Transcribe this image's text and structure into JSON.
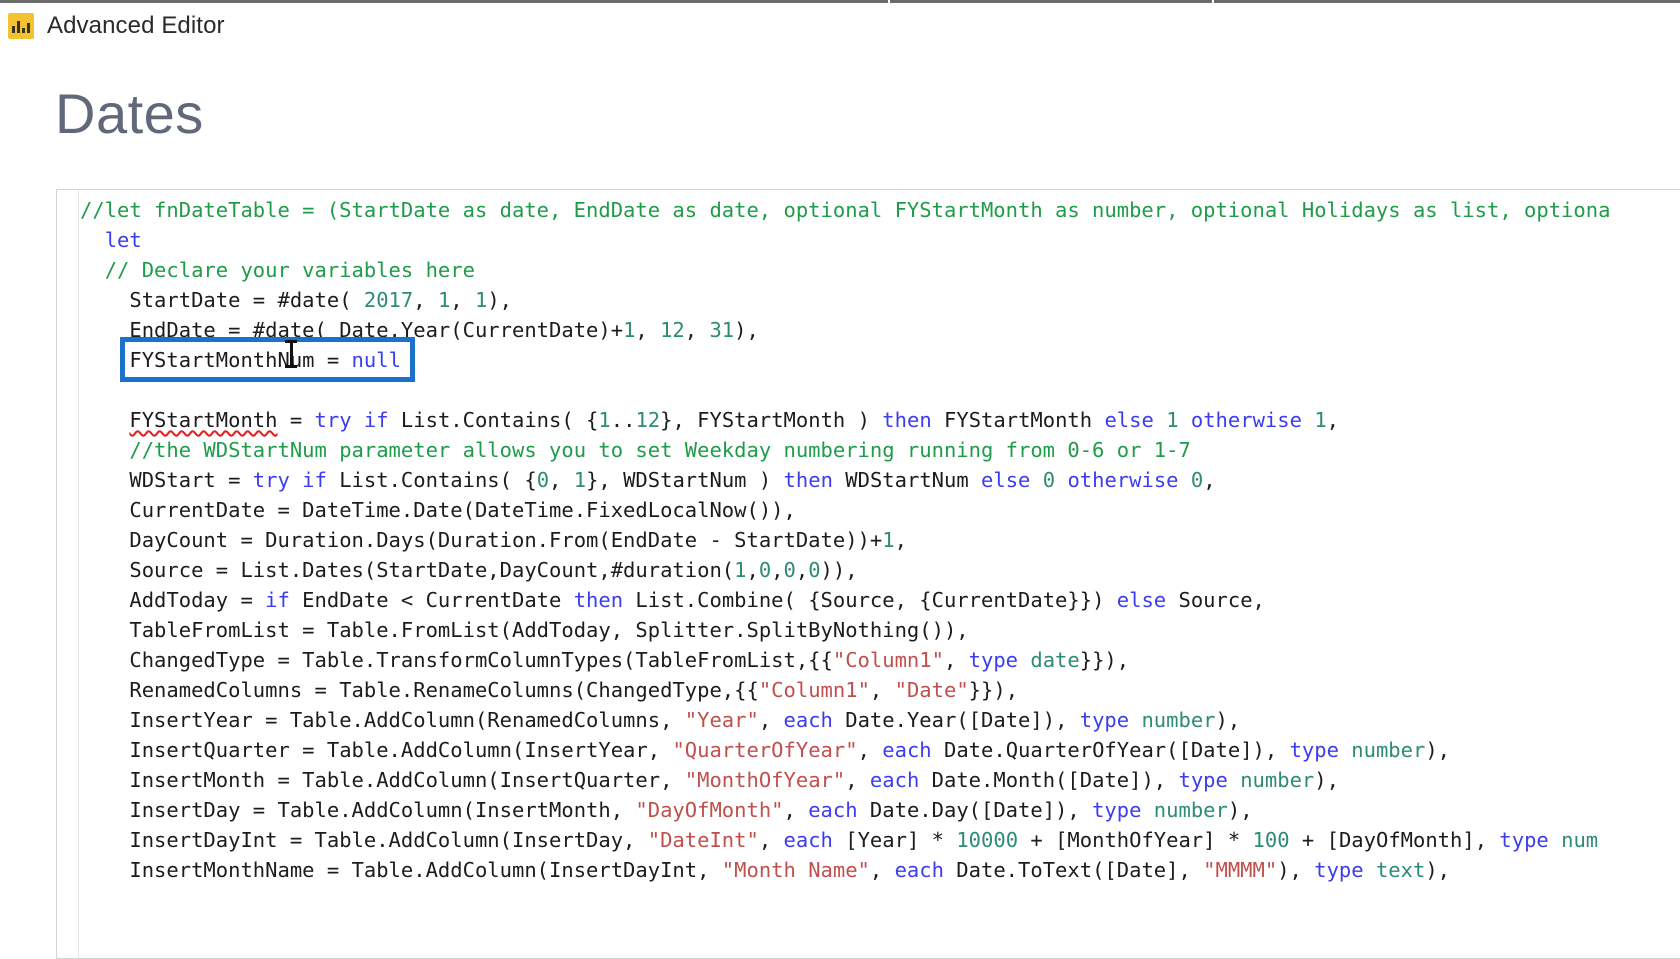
{
  "window": {
    "title": "Advanced Editor",
    "icon": "powerbi-bar-chart-icon"
  },
  "query": {
    "name": "Dates"
  },
  "editor": {
    "language": "M (Power Query)",
    "highlight_box_color": "#1a73c8",
    "highlighted_text": "FYStartMonthNum = null",
    "cursor": "text-ibeam-cursor",
    "lines": [
      {
        "indent": 0,
        "tokens": [
          {
            "t": "//let fnDateTable = (StartDate as date, EndDate as date, optional FYStartMonth as number, optional Holidays as list, optiona",
            "c": "cmt"
          }
        ]
      },
      {
        "indent": 1,
        "tokens": [
          {
            "t": "let",
            "c": "kw"
          }
        ]
      },
      {
        "indent": 1,
        "tokens": [
          {
            "t": "// Declare your variables here",
            "c": "cmt"
          }
        ]
      },
      {
        "indent": 2,
        "tokens": [
          {
            "t": "StartDate = #date( ",
            "c": "plain"
          },
          {
            "t": "2017",
            "c": "num"
          },
          {
            "t": ", ",
            "c": "plain"
          },
          {
            "t": "1",
            "c": "num"
          },
          {
            "t": ", ",
            "c": "plain"
          },
          {
            "t": "1",
            "c": "num"
          },
          {
            "t": "),",
            "c": "plain"
          }
        ]
      },
      {
        "indent": 2,
        "tokens": [
          {
            "t": "EndDate = #date( Date.Year(CurrentDate)+",
            "c": "plain"
          },
          {
            "t": "1",
            "c": "num"
          },
          {
            "t": ", ",
            "c": "plain"
          },
          {
            "t": "12",
            "c": "num"
          },
          {
            "t": ", ",
            "c": "plain"
          },
          {
            "t": "31",
            "c": "num"
          },
          {
            "t": "),",
            "c": "plain"
          }
        ]
      },
      {
        "indent": 2,
        "tokens": [
          {
            "t": "FYStartMonthNum = ",
            "c": "plain"
          },
          {
            "t": "null",
            "c": "kw"
          }
        ]
      },
      {
        "indent": 0,
        "tokens": []
      },
      {
        "indent": 2,
        "tokens": [
          {
            "t": "FYStartMonth",
            "c": "sq"
          },
          {
            "t": " = ",
            "c": "plain"
          },
          {
            "t": "try",
            "c": "kw"
          },
          {
            "t": " ",
            "c": "plain"
          },
          {
            "t": "if",
            "c": "kw"
          },
          {
            "t": " List.Contains( {",
            "c": "plain"
          },
          {
            "t": "1",
            "c": "num"
          },
          {
            "t": "..",
            "c": "plain"
          },
          {
            "t": "12",
            "c": "num"
          },
          {
            "t": "}, FYStartMonth ) ",
            "c": "plain"
          },
          {
            "t": "then",
            "c": "kw"
          },
          {
            "t": " FYStartMonth ",
            "c": "plain"
          },
          {
            "t": "else",
            "c": "kw"
          },
          {
            "t": " ",
            "c": "plain"
          },
          {
            "t": "1",
            "c": "num"
          },
          {
            "t": " ",
            "c": "plain"
          },
          {
            "t": "otherwise",
            "c": "kw"
          },
          {
            "t": " ",
            "c": "plain"
          },
          {
            "t": "1",
            "c": "num"
          },
          {
            "t": ",",
            "c": "plain"
          }
        ]
      },
      {
        "indent": 2,
        "tokens": [
          {
            "t": "//the WDStartNum parameter allows you to set Weekday numbering running from 0-6 or 1-7",
            "c": "cmt"
          }
        ]
      },
      {
        "indent": 2,
        "tokens": [
          {
            "t": "WDStart = ",
            "c": "plain"
          },
          {
            "t": "try",
            "c": "kw"
          },
          {
            "t": " ",
            "c": "plain"
          },
          {
            "t": "if",
            "c": "kw"
          },
          {
            "t": " List.Contains( {",
            "c": "plain"
          },
          {
            "t": "0",
            "c": "num"
          },
          {
            "t": ", ",
            "c": "plain"
          },
          {
            "t": "1",
            "c": "num"
          },
          {
            "t": "}, WDStartNum ) ",
            "c": "plain"
          },
          {
            "t": "then",
            "c": "kw"
          },
          {
            "t": " WDStartNum ",
            "c": "plain"
          },
          {
            "t": "else",
            "c": "kw"
          },
          {
            "t": " ",
            "c": "plain"
          },
          {
            "t": "0",
            "c": "num"
          },
          {
            "t": " ",
            "c": "plain"
          },
          {
            "t": "otherwise",
            "c": "kw"
          },
          {
            "t": " ",
            "c": "plain"
          },
          {
            "t": "0",
            "c": "num"
          },
          {
            "t": ",",
            "c": "plain"
          }
        ]
      },
      {
        "indent": 2,
        "tokens": [
          {
            "t": "CurrentDate = DateTime.Date(DateTime.FixedLocalNow()),",
            "c": "plain"
          }
        ]
      },
      {
        "indent": 2,
        "tokens": [
          {
            "t": "DayCount = Duration.Days(Duration.From(EndDate - StartDate))+",
            "c": "plain"
          },
          {
            "t": "1",
            "c": "num"
          },
          {
            "t": ",",
            "c": "plain"
          }
        ]
      },
      {
        "indent": 2,
        "tokens": [
          {
            "t": "Source = List.Dates(StartDate,DayCount,#duration(",
            "c": "plain"
          },
          {
            "t": "1",
            "c": "num"
          },
          {
            "t": ",",
            "c": "plain"
          },
          {
            "t": "0",
            "c": "num"
          },
          {
            "t": ",",
            "c": "plain"
          },
          {
            "t": "0",
            "c": "num"
          },
          {
            "t": ",",
            "c": "plain"
          },
          {
            "t": "0",
            "c": "num"
          },
          {
            "t": ")),",
            "c": "plain"
          }
        ]
      },
      {
        "indent": 2,
        "tokens": [
          {
            "t": "AddToday = ",
            "c": "plain"
          },
          {
            "t": "if",
            "c": "kw"
          },
          {
            "t": " EndDate < CurrentDate ",
            "c": "plain"
          },
          {
            "t": "then",
            "c": "kw"
          },
          {
            "t": " List.Combine( {Source, {CurrentDate}}) ",
            "c": "plain"
          },
          {
            "t": "else",
            "c": "kw"
          },
          {
            "t": " Source,",
            "c": "plain"
          }
        ]
      },
      {
        "indent": 2,
        "tokens": [
          {
            "t": "TableFromList = Table.FromList(AddToday, Splitter.SplitByNothing()),",
            "c": "plain"
          }
        ]
      },
      {
        "indent": 2,
        "tokens": [
          {
            "t": "ChangedType = Table.TransformColumnTypes(TableFromList,{{",
            "c": "plain"
          },
          {
            "t": "\"Column1\"",
            "c": "str"
          },
          {
            "t": ", ",
            "c": "plain"
          },
          {
            "t": "type",
            "c": "kw"
          },
          {
            "t": " ",
            "c": "plain"
          },
          {
            "t": "date",
            "c": "type"
          },
          {
            "t": "}}),",
            "c": "plain"
          }
        ]
      },
      {
        "indent": 2,
        "tokens": [
          {
            "t": "RenamedColumns = Table.RenameColumns(ChangedType,{{",
            "c": "plain"
          },
          {
            "t": "\"Column1\"",
            "c": "str"
          },
          {
            "t": ", ",
            "c": "plain"
          },
          {
            "t": "\"Date\"",
            "c": "str"
          },
          {
            "t": "}}),",
            "c": "plain"
          }
        ]
      },
      {
        "indent": 2,
        "tokens": [
          {
            "t": "InsertYear = Table.AddColumn(RenamedColumns, ",
            "c": "plain"
          },
          {
            "t": "\"Year\"",
            "c": "str"
          },
          {
            "t": ", ",
            "c": "plain"
          },
          {
            "t": "each",
            "c": "kw"
          },
          {
            "t": " Date.Year([Date]), ",
            "c": "plain"
          },
          {
            "t": "type",
            "c": "kw"
          },
          {
            "t": " ",
            "c": "plain"
          },
          {
            "t": "number",
            "c": "type"
          },
          {
            "t": "),",
            "c": "plain"
          }
        ]
      },
      {
        "indent": 2,
        "tokens": [
          {
            "t": "InsertQuarter = Table.AddColumn(InsertYear, ",
            "c": "plain"
          },
          {
            "t": "\"QuarterOfYear\"",
            "c": "str"
          },
          {
            "t": ", ",
            "c": "plain"
          },
          {
            "t": "each",
            "c": "kw"
          },
          {
            "t": " Date.QuarterOfYear([Date]), ",
            "c": "plain"
          },
          {
            "t": "type",
            "c": "kw"
          },
          {
            "t": " ",
            "c": "plain"
          },
          {
            "t": "number",
            "c": "type"
          },
          {
            "t": "),",
            "c": "plain"
          }
        ]
      },
      {
        "indent": 2,
        "tokens": [
          {
            "t": "InsertMonth = Table.AddColumn(InsertQuarter, ",
            "c": "plain"
          },
          {
            "t": "\"MonthOfYear\"",
            "c": "str"
          },
          {
            "t": ", ",
            "c": "plain"
          },
          {
            "t": "each",
            "c": "kw"
          },
          {
            "t": " Date.Month([Date]), ",
            "c": "plain"
          },
          {
            "t": "type",
            "c": "kw"
          },
          {
            "t": " ",
            "c": "plain"
          },
          {
            "t": "number",
            "c": "type"
          },
          {
            "t": "),",
            "c": "plain"
          }
        ]
      },
      {
        "indent": 2,
        "tokens": [
          {
            "t": "InsertDay = Table.AddColumn(InsertMonth, ",
            "c": "plain"
          },
          {
            "t": "\"DayOfMonth\"",
            "c": "str"
          },
          {
            "t": ", ",
            "c": "plain"
          },
          {
            "t": "each",
            "c": "kw"
          },
          {
            "t": " Date.Day([Date]), ",
            "c": "plain"
          },
          {
            "t": "type",
            "c": "kw"
          },
          {
            "t": " ",
            "c": "plain"
          },
          {
            "t": "number",
            "c": "type"
          },
          {
            "t": "),",
            "c": "plain"
          }
        ]
      },
      {
        "indent": 2,
        "tokens": [
          {
            "t": "InsertDayInt = Table.AddColumn(InsertDay, ",
            "c": "plain"
          },
          {
            "t": "\"DateInt\"",
            "c": "str"
          },
          {
            "t": ", ",
            "c": "plain"
          },
          {
            "t": "each",
            "c": "kw"
          },
          {
            "t": " [Year] * ",
            "c": "plain"
          },
          {
            "t": "10000",
            "c": "num"
          },
          {
            "t": " + [MonthOfYear] * ",
            "c": "plain"
          },
          {
            "t": "100",
            "c": "num"
          },
          {
            "t": " + [DayOfMonth], ",
            "c": "plain"
          },
          {
            "t": "type",
            "c": "kw"
          },
          {
            "t": " ",
            "c": "plain"
          },
          {
            "t": "num",
            "c": "type"
          }
        ]
      },
      {
        "indent": 2,
        "tokens": [
          {
            "t": "InsertMonthName = Table.AddColumn(InsertDayInt, ",
            "c": "plain"
          },
          {
            "t": "\"Month Name\"",
            "c": "str"
          },
          {
            "t": ", ",
            "c": "plain"
          },
          {
            "t": "each",
            "c": "kw"
          },
          {
            "t": " Date.ToText([Date], ",
            "c": "plain"
          },
          {
            "t": "\"MMMM\"",
            "c": "str"
          },
          {
            "t": "), ",
            "c": "plain"
          },
          {
            "t": "type",
            "c": "kw"
          },
          {
            "t": " ",
            "c": "plain"
          },
          {
            "t": "text",
            "c": "type"
          },
          {
            "t": "),",
            "c": "plain"
          }
        ]
      }
    ]
  }
}
